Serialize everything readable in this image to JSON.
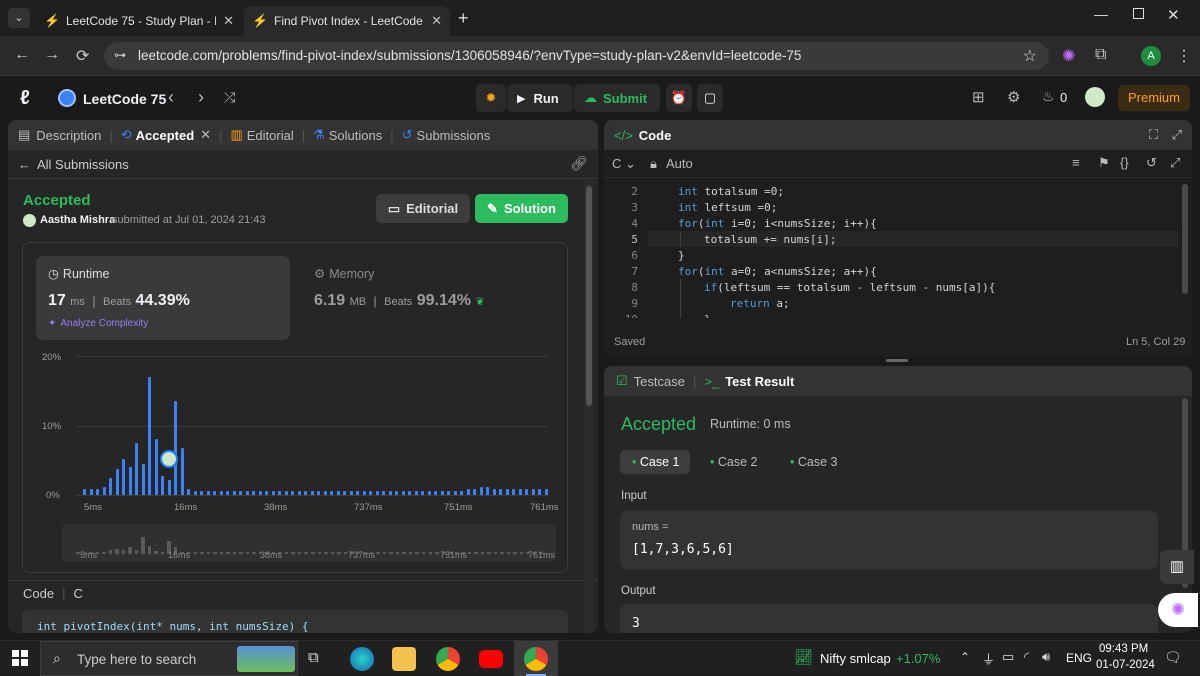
{
  "browser": {
    "tabs": [
      {
        "title": "LeetCode 75 - Study Plan - Leet"
      },
      {
        "title": "Find Pivot Index - LeetCode"
      }
    ],
    "url": "leetcode.com/problems/find-pivot-index/submissions/1306058946/?envType=study-plan-v2&envId=leetcode-75",
    "avatar_letter": "A"
  },
  "header": {
    "study_plan": "LeetCode 75",
    "run_label": "Run",
    "submit_label": "Submit",
    "streak_count": "0",
    "premium_label": "Premium"
  },
  "left_panel": {
    "tabs": [
      "Description",
      "Accepted",
      "Editorial",
      "Solutions",
      "Submissions"
    ],
    "back_label": "All Submissions",
    "status": "Accepted",
    "user": "Aastha Mishra",
    "submitted_text": "submitted at Jul 01, 2024 21:43",
    "editorial_btn": "Editorial",
    "solution_btn": "Solution",
    "runtime": {
      "label": "Runtime",
      "value": "17",
      "unit": "ms",
      "beats_label": "Beats",
      "beats_value": "44.39%",
      "analyze": "Analyze Complexity"
    },
    "memory": {
      "label": "Memory",
      "value": "6.19",
      "unit": "MB",
      "beats_label": "Beats",
      "beats_value": "99.14%"
    },
    "code_label": "Code",
    "code_lang": "C",
    "code_preview": "int pivotIndex(int* nums, int numsSize) {"
  },
  "chart_data": {
    "type": "bar",
    "y_ticks": [
      "20%",
      "10%",
      "0%"
    ],
    "ylim": [
      0,
      20
    ],
    "x_tick_labels": [
      "5ms",
      "16ms",
      "38ms",
      "737ms",
      "751ms",
      "761ms"
    ],
    "values": [
      0.8,
      0.8,
      0.8,
      1.2,
      2.5,
      3.7,
      5.2,
      4.0,
      7.5,
      4.5,
      17.0,
      8.0,
      2.8,
      2.2,
      13.5,
      6.8,
      0.8,
      0.6,
      0.6,
      0.6,
      0.6,
      0.6,
      0.6,
      0.6,
      0.6,
      0.6,
      0.6,
      0.6,
      0.6,
      0.6,
      0.6,
      0.6,
      0.6,
      0.6,
      0.6,
      0.6,
      0.6,
      0.6,
      0.6,
      0.6,
      0.6,
      0.6,
      0.6,
      0.6,
      0.6,
      0.6,
      0.6,
      0.6,
      0.6,
      0.6,
      0.6,
      0.6,
      0.6,
      0.6,
      0.6,
      0.6,
      0.6,
      0.6,
      0.6,
      0.9,
      0.9,
      1.2,
      1.2,
      0.9,
      0.8,
      0.8,
      0.8,
      0.8,
      0.9,
      0.8,
      0.8,
      0.8
    ],
    "highlight_index": 13,
    "overview_labels": [
      "5ms",
      "16ms",
      "38ms",
      "737ms",
      "751ms",
      "761ms"
    ]
  },
  "editor": {
    "title": "Code",
    "language": "C",
    "mode": "Auto",
    "lines": [
      {
        "n": "2",
        "text": "int totalsum =0;",
        "indent": 1
      },
      {
        "n": "3",
        "text": "int leftsum =0;",
        "indent": 1
      },
      {
        "n": "4",
        "text": "for(int i=0; i<numsSize; i++){",
        "indent": 1
      },
      {
        "n": "5",
        "text": "totalsum += nums[i];",
        "indent": 2
      },
      {
        "n": "6",
        "text": "}",
        "indent": 1
      },
      {
        "n": "7",
        "text": "for(int a=0; a<numsSize; a++){",
        "indent": 1
      },
      {
        "n": "8",
        "text": "if(leftsum == totalsum - leftsum - nums[a]){",
        "indent": 2
      },
      {
        "n": "9",
        "text": "return a;",
        "indent": 3
      },
      {
        "n": "10",
        "text": "}",
        "indent": 2
      }
    ],
    "saved": "Saved",
    "cursor": "Ln 5, Col 29"
  },
  "test_panel": {
    "tab_testcase": "Testcase",
    "tab_result": "Test Result",
    "status": "Accepted",
    "runtime_text": "Runtime: 0 ms",
    "cases": [
      "Case 1",
      "Case 2",
      "Case 3"
    ],
    "input_label": "Input",
    "input_var": "nums =",
    "input_value": "[1,7,3,6,5,6]",
    "output_label": "Output",
    "output_value": "3"
  },
  "taskbar": {
    "search_placeholder": "Type here to search",
    "ticker_name": "Nifty smlcap",
    "ticker_change": "+1.07%",
    "lang": "ENG",
    "time": "09:43 PM",
    "date": "01-07-2024"
  },
  "colors": {
    "accent_orange": "#ffa116",
    "accepted_green": "#2cbb5d",
    "chart_blue": "#1a7bff"
  }
}
